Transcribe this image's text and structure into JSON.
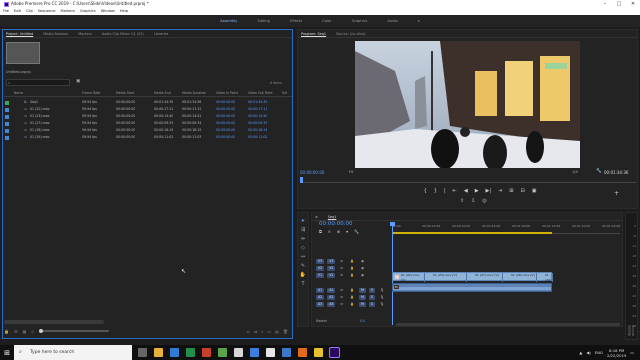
{
  "title": "Adobe Premiere Pro CC 2019 - C:\\Users\\Slide\\Videos\\Untitled.prproj *",
  "window_controls": {
    "minimize": "–",
    "maximize": "□",
    "close": "✕"
  },
  "menu": [
    "File",
    "Edit",
    "Clip",
    "Sequence",
    "Markers",
    "Graphics",
    "Window",
    "Help"
  ],
  "workspaces": [
    "Assembly",
    "Editing",
    "Effects",
    "Color",
    "Graphics",
    "Audio"
  ],
  "workspaces_more": "»",
  "project": {
    "tabs": [
      "Project: Untitled",
      "Media Browser",
      "Markers",
      "Audio Clip Mixer: 01 (25)",
      "Libraries"
    ],
    "name": "Untitled.prproj",
    "items_count": "6 Items",
    "columns": [
      "Name",
      "Frame Rate",
      "Media Start",
      "Media End",
      "Media Duration",
      "Video In Point",
      "Video Out Point",
      "Vid"
    ],
    "rows": [
      {
        "name": "Seq1",
        "color": "#3fa35a",
        "rate": "59.94 fps",
        "start": "00:00:00:00",
        "end": "00:01:34:35",
        "dur": "00:01:34:36",
        "vin": "00:00:00:00",
        "vout": "00:01:34:35"
      },
      {
        "name": "01 (22).mov",
        "color": "#4b86c8",
        "rate": "59.94 fps",
        "start": "00:00:00:00",
        "end": "00:00:17:11",
        "dur": "00:00:17:12",
        "vin": "00:00:00:00",
        "vout": "00:00:17:11"
      },
      {
        "name": "01 (23).mov",
        "color": "#4b86c8",
        "rate": "59.94 fps",
        "start": "00:00:00:00",
        "end": "00:00:14:40",
        "dur": "00:00:14:41",
        "vin": "00:00:00:00",
        "vout": "00:00:14:40"
      },
      {
        "name": "01 (27).mov",
        "color": "#4b86c8",
        "rate": "59.94 fps",
        "start": "00:00:00:00",
        "end": "00:00:09:33",
        "dur": "00:00:09:34",
        "vin": "00:00:00:00",
        "vout": "00:00:09:33"
      },
      {
        "name": "01 (28).mov",
        "color": "#4b86c8",
        "rate": "59.94 fps",
        "start": "00:00:00:00",
        "end": "00:00:16:14",
        "dur": "00:00:16:15",
        "vin": "00:00:00:00",
        "vout": "00:00:16:14"
      },
      {
        "name": "01 (29).mov",
        "color": "#4b86c8",
        "rate": "59.94 fps",
        "start": "00:00:00:00",
        "end": "00:00:11:02",
        "dur": "00:00:11:03",
        "vin": "00:00:00:00",
        "vout": "00:00:11:02"
      }
    ]
  },
  "program": {
    "tabs": [
      "Program: Seq1",
      "Source: (no clips)"
    ],
    "timecode": "00:00:00:00",
    "fit": "Fit",
    "resolution": "1/4",
    "duration": "00:01:34:36"
  },
  "transport": [
    "{",
    "}",
    "|",
    "⇤",
    "◀",
    "▶",
    "▶|",
    "⇥",
    "⊞",
    "⊟",
    "▣"
  ],
  "transport2": [
    "⇧",
    "⇩",
    "◎"
  ],
  "timeline": {
    "tab": "Seq1",
    "timecode": "00:00:00:00",
    "ruler": [
      "00:00",
      "00:00:15:00",
      "00:00:30:00",
      "00:00:45:00",
      "00:01:00:00",
      "00:01:15:00",
      "00:01:30:00",
      "00:01:45:00"
    ],
    "tracks_v": [
      "V3",
      "V2",
      "V1"
    ],
    "tracks_a": [
      "A1",
      "A2",
      "A3"
    ],
    "master": "Master",
    "master_val": "0.0",
    "clip_labels": [
      "01 (22).mov [V]",
      "01 (23).mov [V]",
      "01 (27).mov [V]",
      "01 (28).mov [V]",
      "01 (29)"
    ],
    "fx": "fx"
  },
  "meter": {
    "scale": [
      "0",
      "-6",
      "-12",
      "-18",
      "-24",
      "-30",
      "-36",
      "-42",
      "-48",
      "-54",
      "dB"
    ],
    "labels": [
      "S",
      "S"
    ]
  },
  "taskbar": {
    "search": "Type here to search",
    "time": "8:18 PM",
    "date": "2/22/2019",
    "lang": "ENG"
  }
}
